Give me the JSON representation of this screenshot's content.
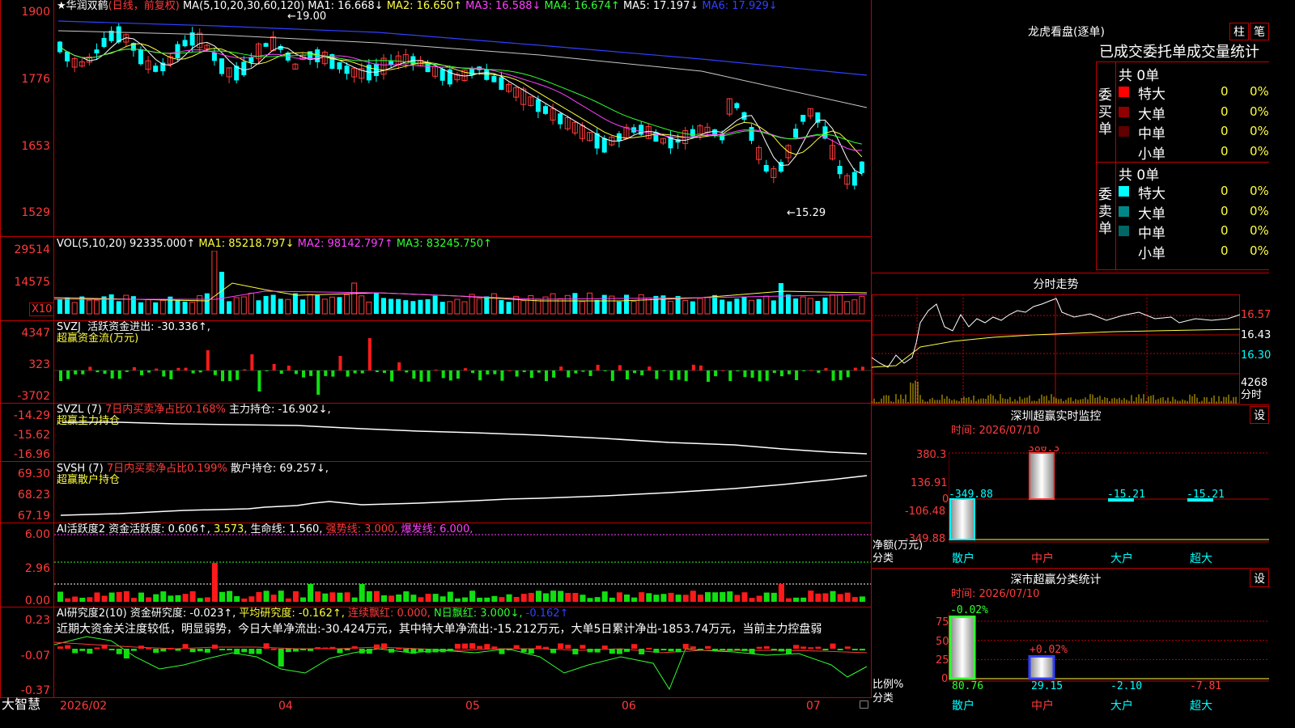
{
  "stock": {
    "star": "★",
    "name": "华润双鹤",
    "period": "(日线，前复权)"
  },
  "main_chart": {
    "ma_params": "MA(5,10,20,30,60,120)",
    "ma": [
      {
        "label": "MA1: 16.668↓",
        "color": "#ffffff"
      },
      {
        "label": "MA2: 16.650↑",
        "color": "#ffff40"
      },
      {
        "label": "MA3: 16.588↓",
        "color": "#ff40ff"
      },
      {
        "label": "MA4: 16.674↑",
        "color": "#30ff30"
      },
      {
        "label": "MA5: 17.197↓",
        "color": "#c8c8c8"
      },
      {
        "label": "MA6: 17.929↓",
        "color": "#3040ff"
      }
    ],
    "y_ticks": [
      "1900",
      "1776",
      "1653",
      "1529"
    ],
    "high_label": "←19.00",
    "low_label": "←15.29"
  },
  "vol_panel": {
    "label": "VOL(5,10,20)",
    "value": "92335.000↑",
    "ma1": "MA1: 85218.797↓",
    "ma2": "MA2: 98142.797↑",
    "ma3": "MA3: 83245.750↑",
    "y_ticks": [
      "29514",
      "14575"
    ],
    "unit": "X10"
  },
  "svzj_panel": {
    "label": "SVZJ",
    "text": "活跃资金进出: -30.336↑,",
    "sub": "超赢资金流(万元)",
    "y_ticks": [
      "4347",
      "323",
      "-3702"
    ]
  },
  "svzl_panel": {
    "label": "SVZL (7)",
    "ratio": "7日内买卖净占比0.168%",
    "hold": "主力持仓: -16.902↓,",
    "sub": "超赢主力持仓",
    "y_ticks": [
      "-14.29",
      "-15.62",
      "-16.96"
    ]
  },
  "svsh_panel": {
    "label": "SVSH (7)",
    "ratio": "7日内买卖净占比0.199%",
    "hold": "散户持仓: 69.257↓,",
    "sub": "超赢散户持仓",
    "y_ticks": [
      "69.30",
      "68.23",
      "67.19"
    ]
  },
  "ai_active": {
    "label": "AI活跃度2",
    "v1": "资金活跃度: 0.606↑,",
    "v2": "3.573,",
    "v3": "生命线: 1.560,",
    "v4": "强势线: 3.000,",
    "v5": "爆发线: 6.000,",
    "y_ticks": [
      "6.00",
      "2.96",
      "0.00"
    ]
  },
  "ai_research": {
    "label": "AI研究度2(10)",
    "v1": "资金研究度: -0.023↑,",
    "v2": "平均研究度: -0.162↑,",
    "v3": "连续飘红: 0.000,",
    "v4": "N日飘红: 3.000↓,",
    "v5": "-0.162↑",
    "comment": "近期大资金关注度较低，明显弱势，今日大单净流出:-30.424万元，其中特大单净流出:-15.212万元，大单5日累计净出-1853.74万元，当前主力控盘弱",
    "y_ticks": [
      "0.23",
      "-0.07",
      "-0.37"
    ]
  },
  "bottom_bar": {
    "logo": "大智慧",
    "dates": [
      "2026/02",
      "04",
      "05",
      "06",
      "07"
    ]
  },
  "dragon_panel": {
    "title": "龙虎看盘(逐单)",
    "btn_bar": "柱",
    "btn_pen": "笔",
    "heading": "已成交委托单成交量统计",
    "buy_label": "委买单",
    "buy_total": "共 0单",
    "sell_label": "委卖单",
    "sell_total": "共 0单",
    "buy_rows": [
      {
        "name": "特大",
        "count": "0",
        "pct": "0%",
        "color": "#ff0000"
      },
      {
        "name": "大单",
        "count": "0",
        "pct": "0%",
        "color": "#900000"
      },
      {
        "name": "中单",
        "count": "0",
        "pct": "0%",
        "color": "#600000"
      },
      {
        "name": "小单",
        "count": "0",
        "pct": "0%",
        "color": "#000000"
      }
    ],
    "sell_rows": [
      {
        "name": "特大",
        "count": "0",
        "pct": "0%",
        "color": "#00ffff"
      },
      {
        "name": "大单",
        "count": "0",
        "pct": "0%",
        "color": "#008888"
      },
      {
        "name": "中单",
        "count": "0",
        "pct": "0%",
        "color": "#006666"
      },
      {
        "name": "小单",
        "count": "0",
        "pct": "0%",
        "color": "#000000"
      }
    ]
  },
  "intraday": {
    "title": "分时走势",
    "price_ticks": [
      "16.57",
      "16.43",
      "16.30"
    ],
    "vol_label": "4268",
    "vol_unit": "分时"
  },
  "sz_monitor": {
    "title": "深圳超赢实时监控",
    "settings": "设",
    "time": "时间: 2026/07/10",
    "y_ticks": [
      "380.3",
      "136.91",
      "0",
      "-106.48",
      "-349.88"
    ],
    "y_title": "净额(万元)",
    "x_title": "分类",
    "values": [
      "-349.88",
      "380.3",
      "-15.21",
      "-15.21"
    ],
    "categories": [
      "散户",
      "中户",
      "大户",
      "超大"
    ]
  },
  "sz_class": {
    "title": "深市超赢分类统计",
    "settings": "设",
    "time": "时间: 2026/07/10",
    "y_ticks": [
      "75",
      "50",
      "25",
      "0"
    ],
    "y_title": "比例%",
    "x_title": "分类",
    "top_labels": [
      "-0.02%",
      "+0.02%"
    ],
    "values": [
      "80.76",
      "29.15",
      "-2.10",
      "-7.81"
    ],
    "categories": [
      "散户",
      "中户",
      "大户",
      "超大"
    ]
  },
  "chart_data": [
    {
      "type": "bar",
      "title": "深圳超赢实时监控",
      "ylabel": "净额(万元)",
      "categories": [
        "散户",
        "中户",
        "大户",
        "超大"
      ],
      "values": [
        -349.88,
        380.3,
        -15.21,
        -15.21
      ],
      "ylim": [
        -349.88,
        380.3
      ]
    },
    {
      "type": "bar",
      "title": "深市超赢分类统计",
      "ylabel": "比例%",
      "categories": [
        "散户",
        "中户",
        "大户",
        "超大"
      ],
      "values": [
        80.76,
        29.15,
        -2.1,
        -7.81
      ],
      "ylim": [
        0,
        75
      ]
    }
  ]
}
